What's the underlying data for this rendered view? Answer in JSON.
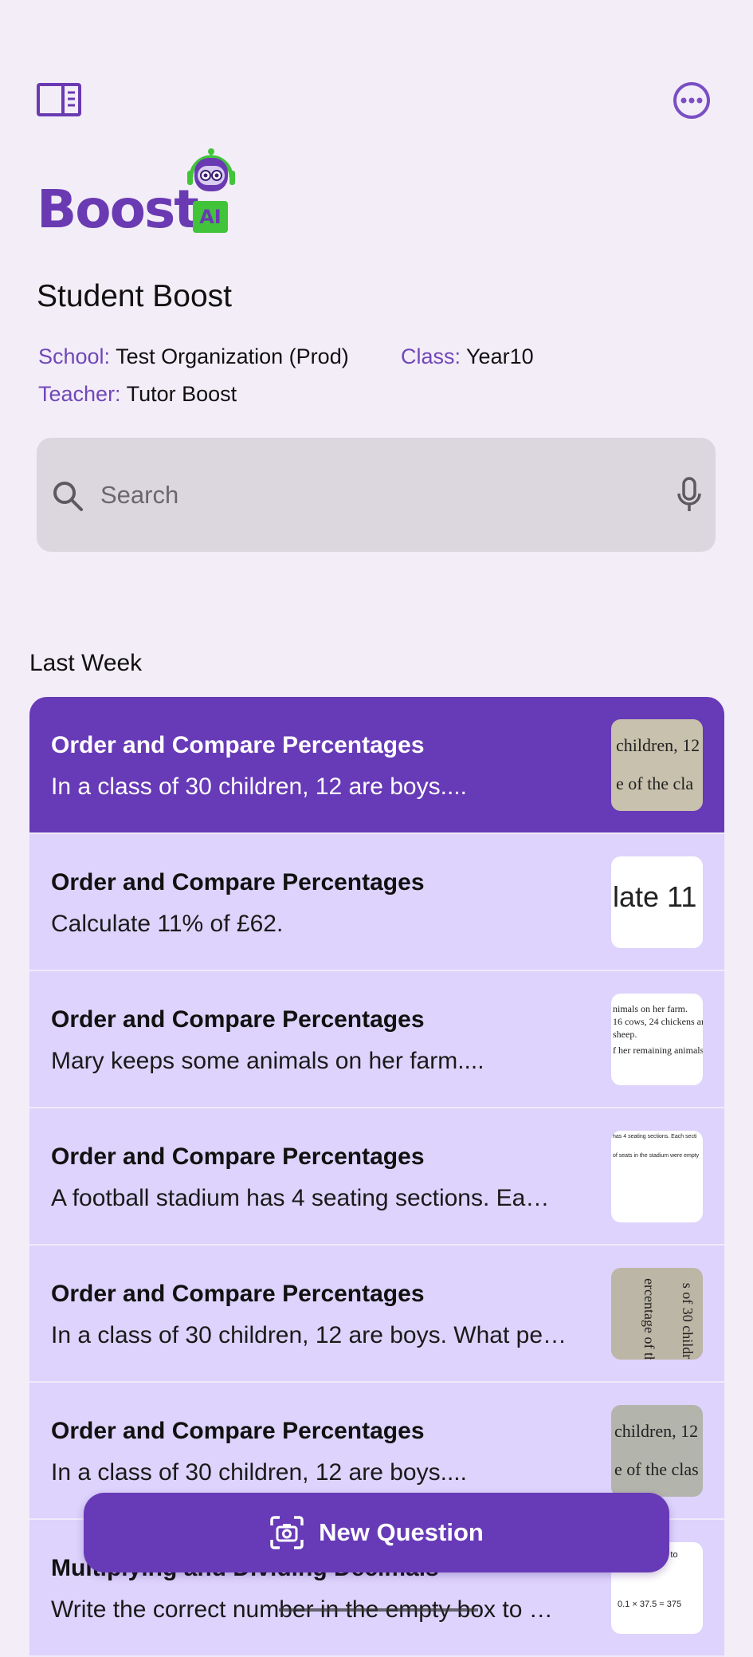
{
  "header": {
    "sidebar_icon": "sidebar-toggle-icon",
    "more_icon": "more-options-icon"
  },
  "logo": {
    "word": "Boost",
    "badge": "AI"
  },
  "title": "Student Boost",
  "meta": {
    "school_label": "School:",
    "school_value": "Test Organization (Prod)",
    "class_label": "Class:",
    "class_value": "Year10",
    "teacher_label": "Teacher:",
    "teacher_value": "Tutor Boost"
  },
  "search": {
    "placeholder": "Search",
    "value": ""
  },
  "section": {
    "heading": "Last Week"
  },
  "items": [
    {
      "title": "Order and Compare Percentages",
      "subtitle": "In a class of 30 children, 12 are boys....",
      "thumb_text": [
        "children, 12",
        "e of the cla"
      ]
    },
    {
      "title": "Order and Compare Percentages",
      "subtitle": "Calculate 11% of £62.",
      "thumb_text": [
        "late 11"
      ]
    },
    {
      "title": "Order and Compare Percentages",
      "subtitle": "Mary keeps some animals on her farm....",
      "thumb_text": [
        "nimals on her farm.",
        "16 cows, 24 chickens an",
        "sheep.",
        "f her remaining animals"
      ]
    },
    {
      "title": "Order and Compare Percentages",
      "subtitle": "A football stadium has 4 seating sections. Ea…",
      "thumb_text": [
        "has 4 seating sections. Each secti",
        "of seats in the stadium were empty"
      ]
    },
    {
      "title": "Order and Compare Percentages",
      "subtitle": "In a class of 30 children, 12 are boys. What pe…",
      "thumb_text": [
        "s of 30 childr",
        "ercentage of th"
      ]
    },
    {
      "title": "Order and Compare Percentages",
      "subtitle": "In a class of 30 children, 12 are boys....",
      "thumb_text": [
        "children, 12",
        "e of the clas"
      ]
    },
    {
      "title": "Multiplying and Dividing Decimals",
      "subtitle": "Write the correct number in the empty box to …",
      "thumb_text": [
        "ty box to",
        "0.1 × 37.5 = 375"
      ]
    }
  ],
  "fab": {
    "label": "New Question",
    "icon": "camera-scan-icon"
  },
  "colors": {
    "accent": "#673ab7",
    "background": "#f3edf8",
    "item": "#ddd3fc",
    "logo_green": "#41c43a"
  }
}
